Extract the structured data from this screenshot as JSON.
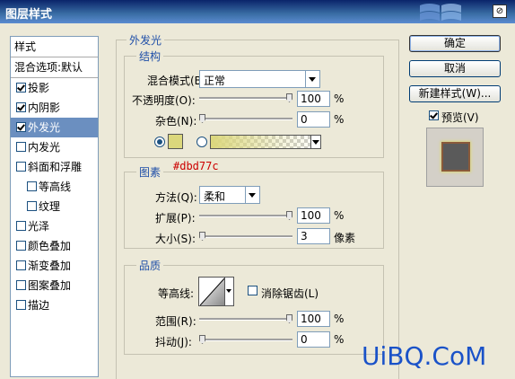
{
  "window": {
    "title": "图层样式",
    "close_glyph": "⊘"
  },
  "styles_panel": {
    "header": "样式",
    "blend_options": "混合选项:默认",
    "items": [
      {
        "label": "投影",
        "checked": true,
        "selected": false,
        "indent": false
      },
      {
        "label": "内阴影",
        "checked": true,
        "selected": false,
        "indent": false
      },
      {
        "label": "外发光",
        "checked": true,
        "selected": true,
        "indent": false
      },
      {
        "label": "内发光",
        "checked": false,
        "selected": false,
        "indent": false
      },
      {
        "label": "斜面和浮雕",
        "checked": false,
        "selected": false,
        "indent": false
      },
      {
        "label": "等高线",
        "checked": false,
        "selected": false,
        "indent": true
      },
      {
        "label": "纹理",
        "checked": false,
        "selected": false,
        "indent": true
      },
      {
        "label": "光泽",
        "checked": false,
        "selected": false,
        "indent": false
      },
      {
        "label": "颜色叠加",
        "checked": false,
        "selected": false,
        "indent": false
      },
      {
        "label": "渐变叠加",
        "checked": false,
        "selected": false,
        "indent": false
      },
      {
        "label": "图案叠加",
        "checked": false,
        "selected": false,
        "indent": false
      },
      {
        "label": "描边",
        "checked": false,
        "selected": false,
        "indent": false
      }
    ]
  },
  "outer_glow": {
    "title": "外发光",
    "structure": {
      "title": "结构",
      "blend_mode_label": "混合模式(B):",
      "blend_mode_value": "正常",
      "opacity_label": "不透明度(O):",
      "opacity_value": "100",
      "opacity_unit": "%",
      "opacity_level": 1.0,
      "noise_label": "杂色(N):",
      "noise_value": "0",
      "noise_unit": "%",
      "noise_level": 0.0,
      "color_swatch": "#dbd77c"
    },
    "elements": {
      "title": "图素",
      "color_annotation": "#dbd77c",
      "method_label": "方法(Q):",
      "method_value": "柔和",
      "spread_label": "扩展(P):",
      "spread_value": "100",
      "spread_unit": "%",
      "spread_level": 1.0,
      "size_label": "大小(S):",
      "size_value": "3",
      "size_unit": "像素",
      "size_level": 0.0
    },
    "quality": {
      "title": "品质",
      "contour_label": "等高线:",
      "anti_alias_label": "消除锯齿(L)",
      "anti_alias_checked": false,
      "range_label": "范围(R):",
      "range_value": "100",
      "range_unit": "%",
      "range_level": 1.0,
      "jitter_label": "抖动(J):",
      "jitter_value": "0",
      "jitter_unit": "%",
      "jitter_level": 0.0
    }
  },
  "buttons": {
    "ok": "确定",
    "cancel": "取消",
    "new_style": "新建样式(W)...",
    "preview_label": "预览(V)",
    "preview_checked": true
  },
  "watermark": "UiBQ.CoM",
  "colors": {
    "annotation": "#cc0000",
    "glow": "#dbd77c",
    "selection": "#6b8fc0"
  }
}
